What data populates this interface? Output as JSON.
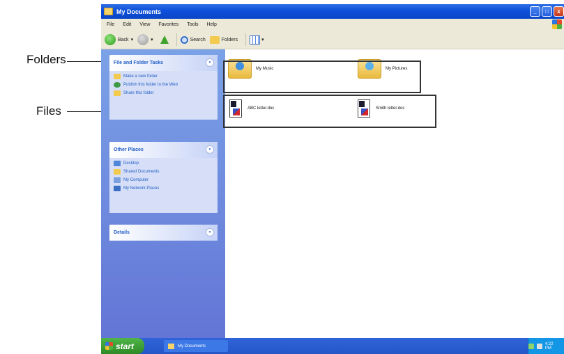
{
  "annotations": {
    "folders_label": "Folders",
    "files_label": "Files"
  },
  "window": {
    "title": "My Documents",
    "controls": {
      "minimize": "_",
      "maximize": "□",
      "close": "x"
    }
  },
  "menu": [
    "File",
    "Edit",
    "View",
    "Favorites",
    "Tools",
    "Help"
  ],
  "toolbar": {
    "back_label": "Back",
    "search_label": "Search",
    "folders_label": "Folders"
  },
  "taskpane": {
    "file_folder_tasks": {
      "title": "File and Folder Tasks",
      "items": [
        "Make a new folder",
        "Publish this folder to the Web",
        "Share this folder"
      ]
    },
    "other_places": {
      "title": "Other Places",
      "items": [
        "Desktop",
        "Shared Documents",
        "My Computer",
        "My Network Places"
      ]
    },
    "details": {
      "title": "Details"
    },
    "collapse_glyph": "«",
    "expand_glyph": "»"
  },
  "content": {
    "folders": [
      {
        "name": "My Music",
        "icon": "music-folder-icon"
      },
      {
        "name": "My Pictures",
        "icon": "pictures-folder-icon"
      }
    ],
    "files": [
      {
        "name": "ABC letter.doc",
        "icon": "document-icon"
      },
      {
        "name": "Smith letter.doc",
        "icon": "document-icon"
      }
    ]
  },
  "taskbar": {
    "start_label": "start",
    "window_button": "My Documents",
    "clock": "4:22 PM"
  },
  "colors": {
    "titlebar": "#0d4fd9",
    "taskpane": "#6e8cdf",
    "start_button": "#3aa033"
  }
}
